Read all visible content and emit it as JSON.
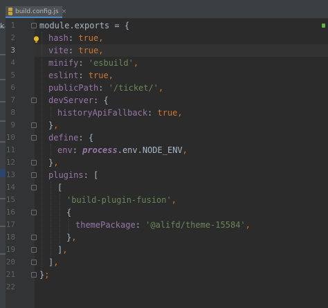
{
  "tab": {
    "filename": "build.config.js",
    "close": "×"
  },
  "left_panel": {
    "fragment": "k"
  },
  "gutter": {
    "line_numbers": [
      "1",
      "2",
      "3",
      "4",
      "5",
      "6",
      "7",
      "8",
      "9",
      "10",
      "11",
      "12",
      "13",
      "14",
      "15",
      "16",
      "17",
      "18",
      "19",
      "20",
      "21",
      "22"
    ],
    "active_line": "3"
  },
  "editor": {
    "line1": {
      "a": "module.exports",
      "b": " = {"
    },
    "line2": {
      "key": "hash",
      "colon": ": ",
      "val": "true",
      "comma": ","
    },
    "line3": {
      "key": "vite",
      "colon": ": ",
      "val": "true",
      "comma": ","
    },
    "line4": {
      "key": "minify",
      "colon": ": ",
      "val": "'esbuild'",
      "comma": ","
    },
    "line5": {
      "key": "eslint",
      "colon": ": ",
      "val": "true",
      "comma": ","
    },
    "line6": {
      "key": "publicPath",
      "colon": ": ",
      "val": "'/ticket/'",
      "comma": ","
    },
    "line7": {
      "key": "devServer",
      "colon": ": ",
      "val": "{"
    },
    "line8": {
      "key": "historyApiFallback",
      "colon": ": ",
      "val": "true",
      "comma": ","
    },
    "line9": {
      "a": "}",
      "comma": ","
    },
    "line10": {
      "key": "define",
      "colon": ": ",
      "val": "{"
    },
    "line11": {
      "key": "env",
      "colon": ": ",
      "glob": "process",
      "rest": ".env.NODE_ENV",
      "comma": ","
    },
    "line12": {
      "a": "}",
      "comma": ","
    },
    "line13": {
      "key": "plugins",
      "colon": ": ",
      "val": "["
    },
    "line14": {
      "a": "["
    },
    "line15": {
      "val": "'build-plugin-fusion'",
      "comma": ","
    },
    "line16": {
      "a": "{"
    },
    "line17": {
      "key": "themePackage",
      "colon": ": ",
      "val": "'@alifd/theme-15584'",
      "comma": ","
    },
    "line18": {
      "a": "}",
      "comma": ","
    },
    "line19": {
      "a": "]",
      "comma": ","
    },
    "line20": {
      "a": "]",
      "comma": ","
    },
    "line21": {
      "a": "}",
      "semi": ";"
    },
    "line22": {
      "a": ""
    }
  },
  "colors": {
    "background": "#2b2b2b",
    "keyword": "#cc7832",
    "string": "#6a8759",
    "property": "#9876aa",
    "text": "#a9b7c6"
  }
}
